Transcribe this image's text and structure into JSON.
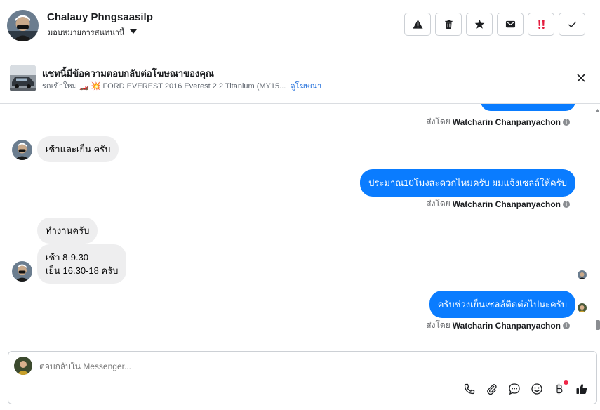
{
  "header": {
    "contact_name": "Chalauy Phngsaasilp",
    "assign_label": "มอบหมายการสนทนานี้",
    "actions": [
      {
        "name": "report-button",
        "icon": "warning-icon"
      },
      {
        "name": "delete-button",
        "icon": "trash-icon"
      },
      {
        "name": "star-button",
        "icon": "star-icon"
      },
      {
        "name": "mark-unread-button",
        "icon": "envelope-icon"
      },
      {
        "name": "spam-button",
        "icon": "exclamation-icon"
      },
      {
        "name": "done-button",
        "icon": "check-icon"
      }
    ]
  },
  "ad": {
    "title": "แชทนี้มีข้อความตอบกลับต่อโฆษณาของคุณ",
    "subtitle": "รถเข้าใหม่ 🏎️ 💥 FORD EVEREST 2016 Everest 2.2 Titanium (MY15...",
    "link_label": "ดูโฆษณา"
  },
  "messages": {
    "sent_by_prefix": "ส่งโดย",
    "agent_name": "Watcharin Chanpanyachon",
    "m1_in": "เช้าและเย็น ครับ",
    "m2_out": "ประมาณ10โมงสะดวกไหมครับ ผมแจ้งเซลล์ให้ครับ",
    "m3_in": "ทำงานครับ",
    "m4_in_line1": "เช้า 8-9.30",
    "m4_in_line2": "เย็น 16.30-18   ครับ",
    "m5_out": "ครับช่วงเย็นเซลล์ติดต่อไปนะครับ"
  },
  "composer": {
    "placeholder": "ตอบกลับใน Messenger...",
    "tools": [
      "phone-icon",
      "paperclip-icon",
      "chat-bubble-icon",
      "emoji-icon",
      "baht-icon",
      "thumbs-up-icon"
    ]
  },
  "colors": {
    "outgoing_bubble": "#0a7cff",
    "incoming_bubble": "#eeeeef",
    "link": "#216fdb",
    "spam_red": "#e41e3f"
  }
}
